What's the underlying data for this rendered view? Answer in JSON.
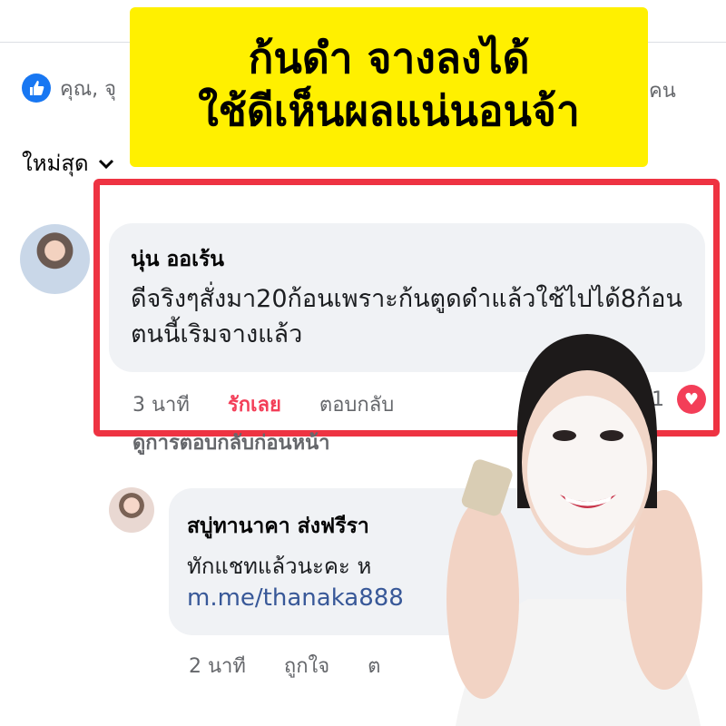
{
  "header": {
    "likes_text": "คุณ, จุ",
    "likes_suffix": "คน"
  },
  "sort": {
    "label": "ใหม่สุด"
  },
  "banner": {
    "line1": "ก้นดำ จางลงได้",
    "line2": "ใช้ดีเห็นผลแน่นอนจ้า",
    "background": "#fff000"
  },
  "comment1": {
    "author": "นุ่น ออเร้น",
    "text": "ดีจริงๆสั่งมา20ก้อนเพราะก้นตูดดำแล้วใช้ไปได้8ก้อนตนนี้เริมจางแล้ว",
    "time": "3 นาที",
    "love_label": "รักเลย",
    "reply_label": "ตอบกลับ",
    "reaction_count": "1",
    "reaction_icon": "heart-icon"
  },
  "previous_replies_label": "ดูการตอบกลับก่อนหน้า",
  "comment2": {
    "author": "สบู่ทานาคา ส่งฟรีรา",
    "text": "ทักแชทแล้วนะคะ ห",
    "link": "m.me/thanaka888",
    "time": "2 นาที",
    "like_label": "ถูกใจ",
    "reply_label": "ต"
  },
  "colors": {
    "accent_red": "#ee3342",
    "facebook_blue": "#1877f2",
    "love_red": "#f33e58"
  }
}
